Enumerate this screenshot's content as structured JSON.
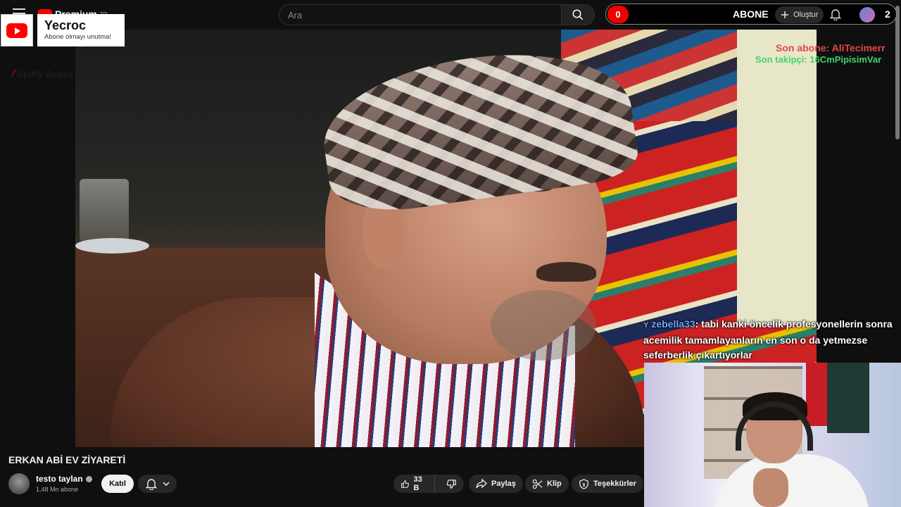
{
  "masthead": {
    "logo_word": "Premium",
    "logo_region": "TR",
    "search_placeholder": "Ara",
    "create_label": "Oluştur",
    "notifications_count": "2"
  },
  "subscriber_goal": {
    "count": "0",
    "label": "ABONE"
  },
  "channel_card": {
    "name": "Yecroc",
    "tagline": "Abone olmayı unutma!"
  },
  "watermark": {
    "text": "Spiffy Geese"
  },
  "stream_overlay": {
    "last_subscriber": "Son abone: AliTecimerr",
    "last_follower": "Son takipçi: 16CmPipisimVar"
  },
  "chat": {
    "badge": "Y",
    "user": "zebella33",
    "message": ": tabi kanki öncelik profesyonellerin sonra acemilik tamamlayanların en son o da yetmezse seferberlik çıkartıyorlar"
  },
  "video": {
    "title": "ERKAN ABİ EV ZİYARETİ",
    "owner_name": "testo taylan",
    "owner_subs": "1,48 Mn abone",
    "join_label": "Katıl",
    "like_count": "33 B",
    "share_label": "Paylaş",
    "clip_label": "Klip",
    "thanks_label": "Teşekkürler"
  },
  "colors": {
    "accent_red": "#ff0000",
    "last_sub_color": "#e04848",
    "last_follow_color": "#3fd46a",
    "chat_user_color": "#6ea6ff",
    "background": "#0f0f0f"
  },
  "icons": [
    "hamburger-icon",
    "youtube-logo-icon",
    "search-icon",
    "plus-icon",
    "bell-icon",
    "avatar",
    "like-icon",
    "dislike-icon",
    "share-icon",
    "scissors-icon",
    "thanks-icon",
    "chevron-down-icon",
    "verified-icon"
  ]
}
